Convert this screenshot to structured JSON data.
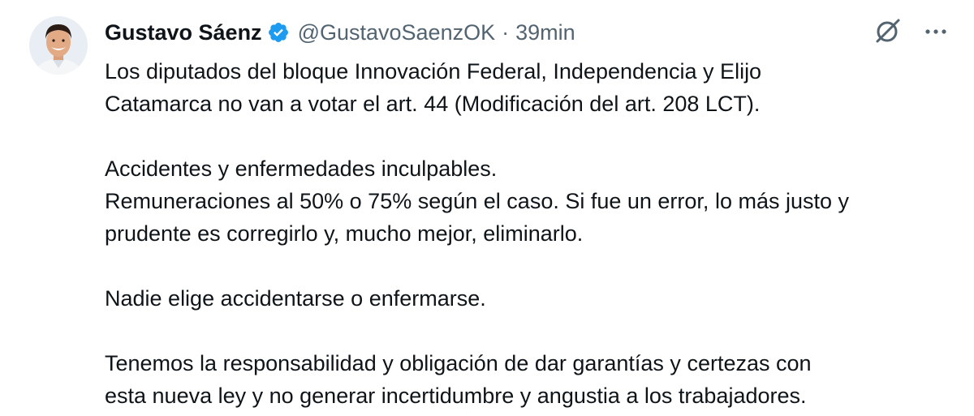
{
  "author": {
    "name": "Gustavo Sáenz",
    "handle": "@GustavoSaenzOK",
    "separator": "·",
    "time": "39min"
  },
  "icons": {
    "verified": "verified-badge-icon",
    "grok": "grok-icon",
    "more": "more-options-icon"
  },
  "colors": {
    "verified": "#1d9bf0",
    "text": "#0f1419",
    "secondary": "#536471"
  },
  "tweet": {
    "p1_line1": "Los diputados del bloque Innovación Federal, Independencia y Elijo",
    "p1_line2": "Catamarca no van a votar el art. 44 (Modificación del art. 208 LCT).",
    "p2_line1": "Accidentes y enfermedades inculpables.",
    "p2_line2": "Remuneraciones al 50% o 75% según el caso. Si fue un error, lo más justo y",
    "p2_line3": "prudente es corregirlo y, mucho mejor, eliminarlo.",
    "p3_line1": "Nadie elige accidentarse o enfermarse.",
    "p4_line1": "Tenemos la responsabilidad y obligación de dar garantías y certezas con",
    "p4_line2": "esta nueva ley y no generar incertidumbre y angustia a los trabajadores."
  }
}
